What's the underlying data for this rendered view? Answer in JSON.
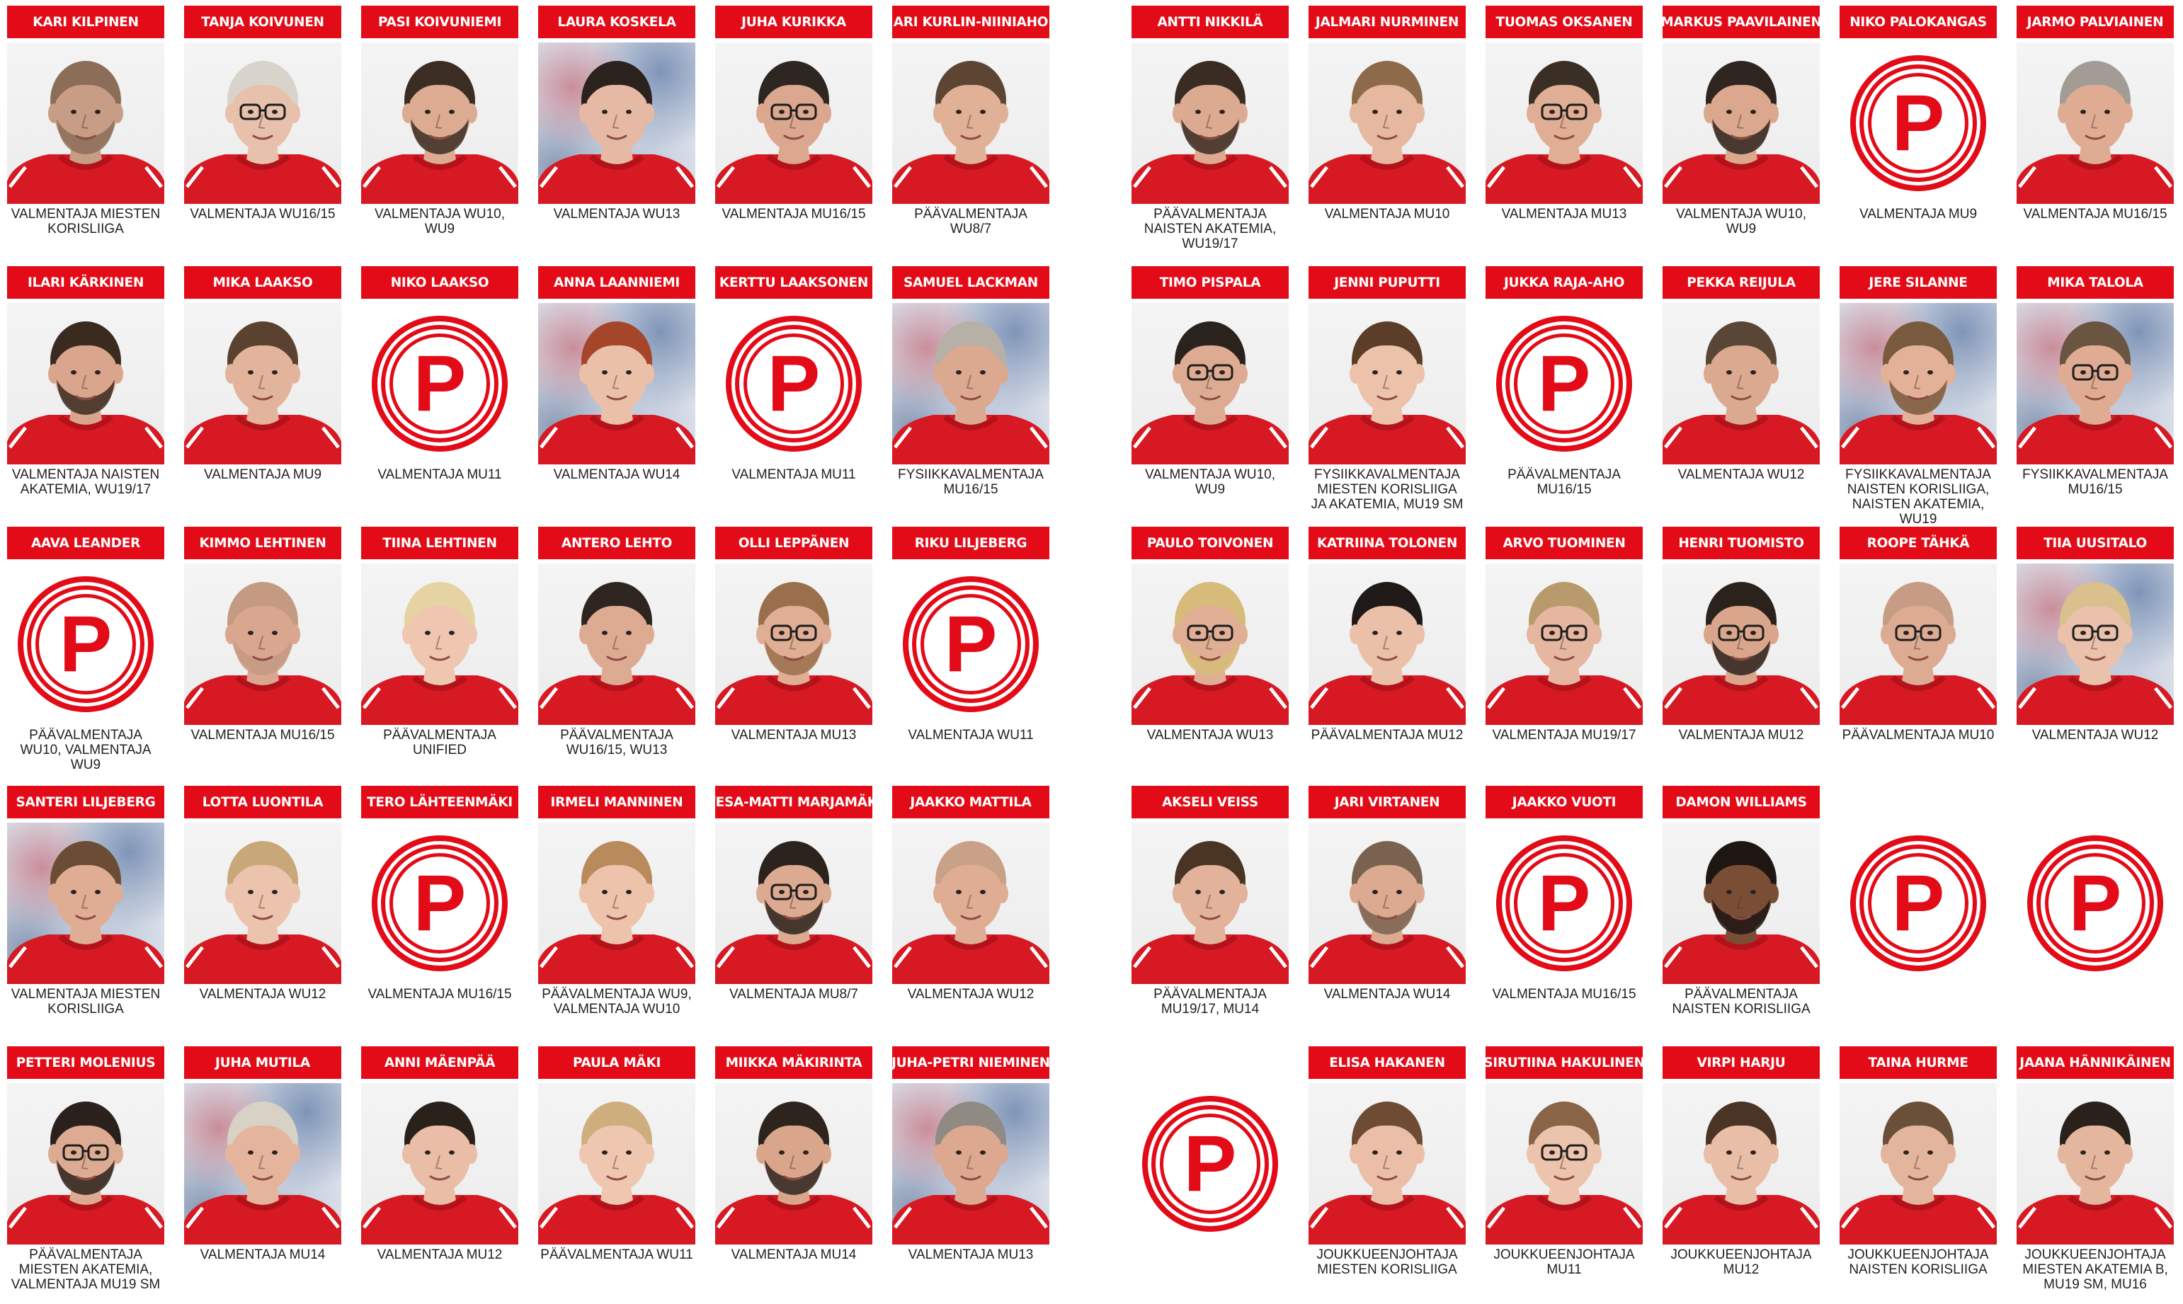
{
  "colors": {
    "brand_red": "#e30b17",
    "jersey_red": "#d61923",
    "text": "#222222"
  },
  "logo_letter": "P",
  "left_panel": [
    [
      {
        "name": "KARI KILPINEN",
        "role": "VALMENTAJA MIESTEN KORISLIIGA",
        "photo": "studio",
        "skin": "#c79d86",
        "hair": "#8c6e58",
        "glasses": false,
        "beard": true
      },
      {
        "name": "TANJA KOIVUNEN",
        "role": "VALMENTAJA WU16/15",
        "photo": "studio",
        "skin": "#e8c1ad",
        "hair": "#d8d4cc",
        "glasses": true,
        "beard": false
      },
      {
        "name": "PASI KOIVUNIEMI",
        "role": "VALMENTAJA WU10, WU9",
        "photo": "studio",
        "skin": "#dcab92",
        "hair": "#3b2d24",
        "glasses": false,
        "beard": true
      },
      {
        "name": "LAURA KOSKELA",
        "role": "VALMENTAJA WU13",
        "photo": "marble",
        "skin": "#e6b9a4",
        "hair": "#2b221d",
        "glasses": false,
        "beard": false
      },
      {
        "name": "JUHA KURIKKA",
        "role": "VALMENTAJA MU16/15",
        "photo": "studio",
        "skin": "#dba78e",
        "hair": "#2e2620",
        "glasses": true,
        "beard": false
      },
      {
        "name": "ARI KURLIN-NIINIAHO",
        "role": "PÄÄVALMENTAJA WU8/7",
        "photo": "studio",
        "skin": "#e0b097",
        "hair": "#5d4534",
        "glasses": false,
        "beard": false
      }
    ],
    [
      {
        "name": "ILARI KÄRKINEN",
        "role": "VALMENTAJA NAISTEN AKATEMIA, WU19/17",
        "photo": "studio",
        "skin": "#d9a68d",
        "hair": "#3a2a20",
        "glasses": false,
        "beard": true
      },
      {
        "name": "MIKA LAAKSO",
        "role": "VALMENTAJA MU9",
        "photo": "studio",
        "skin": "#e2b49b",
        "hair": "#5a4130",
        "glasses": false,
        "beard": false
      },
      {
        "name": "NIKO LAAKSO",
        "role": "VALMENTAJA MU11",
        "photo": "logo"
      },
      {
        "name": "ANNA LAANNIEMI",
        "role": "VALMENTAJA WU14",
        "photo": "marble",
        "skin": "#ebc0a8",
        "hair": "#a5462a",
        "glasses": false,
        "beard": false
      },
      {
        "name": "KERTTU LAAKSONEN",
        "role": "VALMENTAJA MU11",
        "photo": "logo"
      },
      {
        "name": "SAMUEL LACKMAN",
        "role": "FYSIIKKAVALMENTAJA MU16/15",
        "photo": "marble",
        "skin": "#dba990",
        "hair": "#b7b0a6",
        "glasses": false,
        "beard": false
      }
    ],
    [
      {
        "name": "AAVA LEANDER",
        "role": "PÄÄVALMENTAJA WU10, VALMENTAJA WU9",
        "photo": "logo"
      },
      {
        "name": "KIMMO LEHTINEN",
        "role": "VALMENTAJA MU16/15",
        "photo": "studio",
        "skin": "#d9a78f",
        "hair": "#c49a82",
        "glasses": false,
        "beard": true
      },
      {
        "name": "TIINA LEHTINEN",
        "role": "PÄÄVALMENTAJA UNIFIED",
        "photo": "studio",
        "skin": "#efc6b0",
        "hair": "#e6d3a4",
        "glasses": false,
        "beard": false
      },
      {
        "name": "ANTERO LEHTO",
        "role": "PÄÄVALMENTAJA WU16/15, WU13",
        "photo": "studio",
        "skin": "#ddab92",
        "hair": "#2e2520",
        "glasses": false,
        "beard": false
      },
      {
        "name": "OLLI LEPPÄNEN",
        "role": "VALMENTAJA MU13",
        "photo": "studio",
        "skin": "#e0ae94",
        "hair": "#9a6f4c",
        "glasses": true,
        "beard": true
      },
      {
        "name": "RIKU LILJEBERG",
        "role": "VALMENTAJA WU11",
        "photo": "logo"
      }
    ],
    [
      {
        "name": "SANTERI LILJEBERG",
        "role": "VALMENTAJA MIESTEN KORISLIIGA",
        "photo": "marble",
        "skin": "#dfad94",
        "hair": "#6b4c35",
        "glasses": false,
        "beard": false
      },
      {
        "name": "LOTTA LUONTILA",
        "role": "VALMENTAJA WU12",
        "photo": "studio",
        "skin": "#ecc3ad",
        "hair": "#c8a878",
        "glasses": false,
        "beard": false
      },
      {
        "name": "TERO LÄHTEENMÄKI",
        "role": "VALMENTAJA MU16/15",
        "photo": "logo"
      },
      {
        "name": "IRMELI MANNINEN",
        "role": "PÄÄVALMENTAJA WU9, VALMENTAJA WU10",
        "photo": "studio",
        "skin": "#edc3ab",
        "hair": "#b88a5c",
        "glasses": false,
        "beard": false
      },
      {
        "name": "VESA-MATTI MARJAMÄKI",
        "role": "VALMENTAJA MU8/7",
        "photo": "studio",
        "skin": "#dcaa90",
        "hair": "#2c231d",
        "glasses": true,
        "beard": true
      },
      {
        "name": "JAAKKO MATTILA",
        "role": "VALMENTAJA WU12",
        "photo": "studio",
        "skin": "#dfad94",
        "hair": "#c9a188",
        "glasses": false,
        "beard": false
      }
    ],
    [
      {
        "name": "PETTERI MOLENIUS",
        "role": "PÄÄVALMENTAJA MIESTEN AKATEMIA, VALMENTAJA MU19 SM",
        "photo": "studio",
        "skin": "#dcab92",
        "hair": "#2a211c",
        "glasses": true,
        "beard": true
      },
      {
        "name": "JUHA MUTILA",
        "role": "VALMENTAJA MU14",
        "photo": "marble",
        "skin": "#e4b59c",
        "hair": "#d8d2c6",
        "glasses": false,
        "beard": false
      },
      {
        "name": "ANNI MÄENPÄÄ",
        "role": "VALMENTAJA MU12",
        "photo": "studio",
        "skin": "#e9bda6",
        "hair": "#2b211b",
        "glasses": false,
        "beard": false
      },
      {
        "name": "PAULA MÄKI",
        "role": "PÄÄVALMENTAJA WU11",
        "photo": "studio",
        "skin": "#efc7b0",
        "hair": "#cfae7e",
        "glasses": false,
        "beard": false
      },
      {
        "name": "MIIKKA MÄKIRINTA",
        "role": "VALMENTAJA MU14",
        "photo": "studio",
        "skin": "#d9a68c",
        "hair": "#2e241e",
        "glasses": false,
        "beard": true
      },
      {
        "name": "JUHA-PETRI NIEMINEN",
        "role": "VALMENTAJA MU13",
        "photo": "marble",
        "skin": "#dca88f",
        "hair": "#8f8a84",
        "glasses": false,
        "beard": false
      }
    ]
  ],
  "right_panel": [
    [
      {
        "name": "ANTTI NIKKILÄ",
        "role": "PÄÄVALMENTAJA NAISTEN AKATEMIA, WU19/17",
        "photo": "studio",
        "skin": "#dcaa90",
        "hair": "#3a2c22",
        "glasses": false,
        "beard": true
      },
      {
        "name": "JALMARI NURMINEN",
        "role": "VALMENTAJA MU10",
        "photo": "studio",
        "skin": "#e6b89f",
        "hair": "#8c6a4a",
        "glasses": false,
        "beard": false
      },
      {
        "name": "TUOMAS OKSANEN",
        "role": "VALMENTAJA MU13",
        "photo": "studio",
        "skin": "#e0ae95",
        "hair": "#3b2e24",
        "glasses": true,
        "beard": false
      },
      {
        "name": "MARKUS PAAVILAINEN",
        "role": "VALMENTAJA WU10, WU9",
        "photo": "studio",
        "skin": "#dba78e",
        "hair": "#2f2520",
        "glasses": false,
        "beard": true
      },
      {
        "name": "NIKO PALOKANGAS",
        "role": "VALMENTAJA MU9",
        "photo": "logo"
      },
      {
        "name": "JARMO PALVIAINEN",
        "role": "VALMENTAJA MU16/15",
        "photo": "studio",
        "skin": "#dfac93",
        "hair": "#a29c95",
        "glasses": false,
        "beard": false
      }
    ],
    [
      {
        "name": "TIMO PISPALA",
        "role": "VALMENTAJA WU10, WU9",
        "photo": "studio",
        "skin": "#dcab92",
        "hair": "#2a221d",
        "glasses": true,
        "beard": false
      },
      {
        "name": "JENNI PUPUTTI",
        "role": "FYSIIKKAVALMENTAJA MIESTEN KORISLIIGA JA AKATEMIA, MU19 SM",
        "photo": "studio",
        "skin": "#ecc2ab",
        "hair": "#5c3e28",
        "glasses": false,
        "beard": false
      },
      {
        "name": "JUKKA RAJA-AHO",
        "role": "PÄÄVALMENTAJA MU16/15",
        "photo": "logo"
      },
      {
        "name": "PEKKA REIJULA",
        "role": "VALMENTAJA WU12",
        "photo": "studio",
        "skin": "#dba98f",
        "hair": "#5a4636",
        "glasses": false,
        "beard": false
      },
      {
        "name": "JERE SILANNE",
        "role": "FYSIIKKAVALMENTAJA NAISTEN KORISLIIGA, NAISTEN AKATEMIA, WU19",
        "photo": "marble",
        "skin": "#e2b198",
        "hair": "#7a5a3e",
        "glasses": false,
        "beard": true
      },
      {
        "name": "MIKA TALOLA",
        "role": "FYSIIKKAVALMENTAJA MU16/15",
        "photo": "marble",
        "skin": "#dfac93",
        "hair": "#6a5442",
        "glasses": true,
        "beard": false
      }
    ],
    [
      {
        "name": "PAULO TOIVONEN",
        "role": "VALMENTAJA WU13",
        "photo": "studio",
        "skin": "#e0ae95",
        "hair": "#d6bb7a",
        "glasses": true,
        "beard": true
      },
      {
        "name": "KATRIINA TOLONEN",
        "role": "PÄÄVALMENTAJA MU12",
        "photo": "studio",
        "skin": "#ebc0a8",
        "hair": "#1f1a17",
        "glasses": false,
        "beard": false
      },
      {
        "name": "ARVO TUOMINEN",
        "role": "VALMENTAJA MU19/17",
        "photo": "studio",
        "skin": "#e6b7a0",
        "hair": "#b99a6c",
        "glasses": true,
        "beard": false
      },
      {
        "name": "HENRI TUOMISTO",
        "role": "VALMENTAJA MU12",
        "photo": "studio",
        "skin": "#d9a68c",
        "hair": "#2b221c",
        "glasses": true,
        "beard": true
      },
      {
        "name": "ROOPE TÄHKÄ",
        "role": "PÄÄVALMENTAJA MU10",
        "photo": "studio",
        "skin": "#dcab92",
        "hair": "#c79c84",
        "glasses": true,
        "beard": false
      },
      {
        "name": "TIIA UUSITALO",
        "role": "VALMENTAJA WU12",
        "photo": "marble",
        "skin": "#eac1aa",
        "hair": "#d9c08c",
        "glasses": true,
        "beard": false
      }
    ],
    [
      {
        "name": "AKSELI VEISS",
        "role": "PÄÄVALMENTAJA MU19/17, MU14",
        "photo": "studio",
        "skin": "#e2b29a",
        "hair": "#4a3424",
        "glasses": false,
        "beard": false
      },
      {
        "name": "JARI VIRTANEN",
        "role": "VALMENTAJA WU14",
        "photo": "studio",
        "skin": "#dcaa90",
        "hair": "#7a6250",
        "glasses": false,
        "beard": true
      },
      {
        "name": "JAAKKO VUOTI",
        "role": "VALMENTAJA MU16/15",
        "photo": "logo"
      },
      {
        "name": "DAMON WILLIAMS",
        "role": "PÄÄVALMENTAJA NAISTEN KORISLIIGA",
        "photo": "studio",
        "skin": "#7a4e35",
        "hair": "#1d1613",
        "glasses": false,
        "beard": true
      }
    ],
    [
      {
        "name": "ELISA HAKANEN",
        "role": "JOUKKUEENJOHTAJA MIESTEN KORISLIIGA",
        "photo": "studio",
        "skin": "#ebbfa7",
        "hair": "#6e4c34",
        "glasses": false,
        "beard": false
      },
      {
        "name": "SIRUTIINA HAKULINEN",
        "role": "JOUKKUEENJOHTAJA MU11",
        "photo": "studio",
        "skin": "#ecc3ac",
        "hair": "#8a6446",
        "glasses": true,
        "beard": false
      },
      {
        "name": "VIRPI HARJU",
        "role": "JOUKKUEENJOHTAJA MU12",
        "photo": "studio",
        "skin": "#e9bea7",
        "hair": "#4a3426",
        "glasses": false,
        "beard": false
      },
      {
        "name": "TAINA HURME",
        "role": "JOUKKUEENJOHTAJA NAISTEN KORISLIIGA",
        "photo": "studio",
        "skin": "#e4b59d",
        "hair": "#6a5038",
        "glasses": false,
        "beard": false
      },
      {
        "name": "JAANA HÄNNIKÄINEN",
        "role": "JOUKKUEENJOHTAJA MIESTEN AKATEMIA B, MU19 SM, MU16",
        "photo": "studio",
        "skin": "#e5b69e",
        "hair": "#2a211b",
        "glasses": false,
        "beard": false
      }
    ]
  ]
}
